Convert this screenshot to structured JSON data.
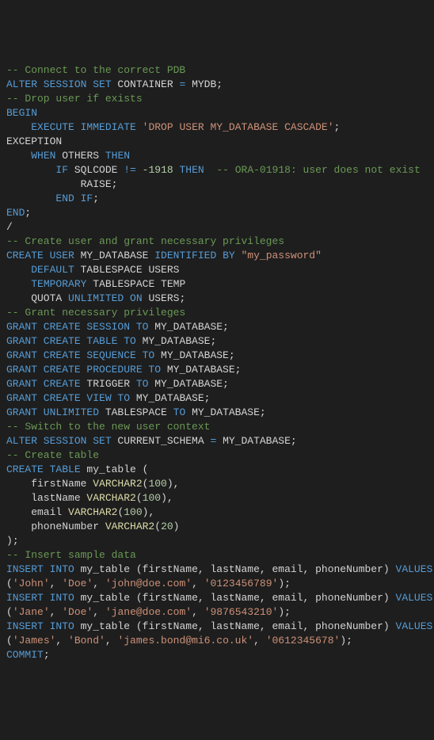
{
  "code": {
    "lines": [
      [
        {
          "cls": "cmt",
          "text": "-- Connect to the correct PDB"
        }
      ],
      [
        {
          "cls": "kw",
          "text": "ALTER SESSION SET"
        },
        {
          "cls": "ident",
          "text": " CONTAINER "
        },
        {
          "cls": "kw",
          "text": "="
        },
        {
          "cls": "ident",
          "text": " MYDB"
        },
        {
          "cls": "ident",
          "text": ";"
        }
      ],
      [
        {
          "cls": "cmt",
          "text": "-- Drop user if exists"
        }
      ],
      [
        {
          "cls": "kw",
          "text": "BEGIN"
        }
      ],
      [
        {
          "cls": "ident",
          "text": "    "
        },
        {
          "cls": "kw",
          "text": "EXECUTE IMMEDIATE"
        },
        {
          "cls": "ident",
          "text": " "
        },
        {
          "cls": "str",
          "text": "'DROP USER MY_DATABASE CASCADE'"
        },
        {
          "cls": "ident",
          "text": ";"
        }
      ],
      [
        {
          "cls": "ident",
          "text": "EXCEPTION"
        }
      ],
      [
        {
          "cls": "ident",
          "text": "    "
        },
        {
          "cls": "kw",
          "text": "WHEN"
        },
        {
          "cls": "ident",
          "text": " OTHERS "
        },
        {
          "cls": "kw",
          "text": "THEN"
        }
      ],
      [
        {
          "cls": "ident",
          "text": "        "
        },
        {
          "cls": "kw",
          "text": "IF"
        },
        {
          "cls": "ident",
          "text": " SQLCODE "
        },
        {
          "cls": "kw",
          "text": "!="
        },
        {
          "cls": "ident",
          "text": " "
        },
        {
          "cls": "num",
          "text": "-1918"
        },
        {
          "cls": "ident",
          "text": " "
        },
        {
          "cls": "kw",
          "text": "THEN"
        },
        {
          "cls": "ident",
          "text": "  "
        },
        {
          "cls": "cmt",
          "text": "-- ORA-01918: user does not exist"
        }
      ],
      [
        {
          "cls": "ident",
          "text": "            RAISE;"
        }
      ],
      [
        {
          "cls": "ident",
          "text": "        "
        },
        {
          "cls": "kw",
          "text": "END IF"
        },
        {
          "cls": "ident",
          "text": ";"
        }
      ],
      [
        {
          "cls": "kw",
          "text": "END"
        },
        {
          "cls": "ident",
          "text": ";"
        }
      ],
      [
        {
          "cls": "ident",
          "text": "/"
        }
      ],
      [
        {
          "cls": "cmt",
          "text": "-- Create user and grant necessary privileges"
        }
      ],
      [
        {
          "cls": "kw",
          "text": "CREATE USER"
        },
        {
          "cls": "ident",
          "text": " MY_DATABASE "
        },
        {
          "cls": "kw",
          "text": "IDENTIFIED BY"
        },
        {
          "cls": "ident",
          "text": " "
        },
        {
          "cls": "str",
          "text": "\"my_password\""
        }
      ],
      [
        {
          "cls": "ident",
          "text": "    "
        },
        {
          "cls": "kw",
          "text": "DEFAULT"
        },
        {
          "cls": "ident",
          "text": " TABLESPACE USERS"
        }
      ],
      [
        {
          "cls": "ident",
          "text": "    "
        },
        {
          "cls": "kw",
          "text": "TEMPORARY"
        },
        {
          "cls": "ident",
          "text": " TABLESPACE TEMP"
        }
      ],
      [
        {
          "cls": "ident",
          "text": "    QUOTA "
        },
        {
          "cls": "kw",
          "text": "UNLIMITED ON"
        },
        {
          "cls": "ident",
          "text": " USERS;"
        }
      ],
      [
        {
          "cls": "cmt",
          "text": "-- Grant necessary privileges"
        }
      ],
      [
        {
          "cls": "kw",
          "text": "GRANT CREATE SESSION TO"
        },
        {
          "cls": "ident",
          "text": " MY_DATABASE;"
        }
      ],
      [
        {
          "cls": "kw",
          "text": "GRANT CREATE TABLE TO"
        },
        {
          "cls": "ident",
          "text": " MY_DATABASE;"
        }
      ],
      [
        {
          "cls": "kw",
          "text": "GRANT CREATE SEQUENCE TO"
        },
        {
          "cls": "ident",
          "text": " MY_DATABASE;"
        }
      ],
      [
        {
          "cls": "kw",
          "text": "GRANT CREATE PROCEDURE TO"
        },
        {
          "cls": "ident",
          "text": " MY_DATABASE;"
        }
      ],
      [
        {
          "cls": "kw",
          "text": "GRANT CREATE"
        },
        {
          "cls": "ident",
          "text": " TRIGGER "
        },
        {
          "cls": "kw",
          "text": "TO"
        },
        {
          "cls": "ident",
          "text": " MY_DATABASE;"
        }
      ],
      [
        {
          "cls": "kw",
          "text": "GRANT CREATE VIEW TO"
        },
        {
          "cls": "ident",
          "text": " MY_DATABASE;"
        }
      ],
      [
        {
          "cls": "kw",
          "text": "GRANT UNLIMITED"
        },
        {
          "cls": "ident",
          "text": " TABLESPACE "
        },
        {
          "cls": "kw",
          "text": "TO"
        },
        {
          "cls": "ident",
          "text": " MY_DATABASE;"
        }
      ],
      [
        {
          "cls": "cmt",
          "text": "-- Switch to the new user context"
        }
      ],
      [
        {
          "cls": "kw",
          "text": "ALTER SESSION SET"
        },
        {
          "cls": "ident",
          "text": " CURRENT_SCHEMA "
        },
        {
          "cls": "kw",
          "text": "="
        },
        {
          "cls": "ident",
          "text": " MY_DATABASE;"
        }
      ],
      [
        {
          "cls": "cmt",
          "text": "-- Create table"
        }
      ],
      [
        {
          "cls": "kw",
          "text": "CREATE TABLE"
        },
        {
          "cls": "ident",
          "text": " my_table "
        },
        {
          "cls": "paren",
          "text": "("
        }
      ],
      [
        {
          "cls": "ident",
          "text": "    firstName "
        },
        {
          "cls": "func",
          "text": "VARCHAR2"
        },
        {
          "cls": "paren",
          "text": "("
        },
        {
          "cls": "num",
          "text": "100"
        },
        {
          "cls": "paren",
          "text": ")"
        },
        {
          "cls": "ident",
          "text": ","
        }
      ],
      [
        {
          "cls": "ident",
          "text": "    lastName "
        },
        {
          "cls": "func",
          "text": "VARCHAR2"
        },
        {
          "cls": "paren",
          "text": "("
        },
        {
          "cls": "num",
          "text": "100"
        },
        {
          "cls": "paren",
          "text": ")"
        },
        {
          "cls": "ident",
          "text": ","
        }
      ],
      [
        {
          "cls": "ident",
          "text": "    email "
        },
        {
          "cls": "func",
          "text": "VARCHAR2"
        },
        {
          "cls": "paren",
          "text": "("
        },
        {
          "cls": "num",
          "text": "100"
        },
        {
          "cls": "paren",
          "text": ")"
        },
        {
          "cls": "ident",
          "text": ","
        }
      ],
      [
        {
          "cls": "ident",
          "text": "    phoneNumber "
        },
        {
          "cls": "func",
          "text": "VARCHAR2"
        },
        {
          "cls": "paren",
          "text": "("
        },
        {
          "cls": "num",
          "text": "20"
        },
        {
          "cls": "paren",
          "text": ")"
        }
      ],
      [
        {
          "cls": "paren",
          "text": ")"
        },
        {
          "cls": "ident",
          "text": ";"
        }
      ],
      [
        {
          "cls": "cmt",
          "text": "-- Insert sample data"
        }
      ],
      [
        {
          "cls": "kw",
          "text": "INSERT INTO"
        },
        {
          "cls": "ident",
          "text": " my_table "
        },
        {
          "cls": "paren",
          "text": "("
        },
        {
          "cls": "ident",
          "text": "firstName, lastName, email, phoneNumber"
        },
        {
          "cls": "paren",
          "text": ")"
        },
        {
          "cls": "ident",
          "text": " "
        },
        {
          "cls": "kw",
          "text": "VALUES"
        }
      ],
      [
        {
          "cls": "paren",
          "text": "("
        },
        {
          "cls": "str",
          "text": "'John'"
        },
        {
          "cls": "ident",
          "text": ", "
        },
        {
          "cls": "str",
          "text": "'Doe'"
        },
        {
          "cls": "ident",
          "text": ", "
        },
        {
          "cls": "str",
          "text": "'john@doe.com'"
        },
        {
          "cls": "ident",
          "text": ", "
        },
        {
          "cls": "str",
          "text": "'0123456789'"
        },
        {
          "cls": "paren",
          "text": ")"
        },
        {
          "cls": "ident",
          "text": ";"
        }
      ],
      [
        {
          "cls": "kw",
          "text": "INSERT INTO"
        },
        {
          "cls": "ident",
          "text": " my_table "
        },
        {
          "cls": "paren",
          "text": "("
        },
        {
          "cls": "ident",
          "text": "firstName, lastName, email, phoneNumber"
        },
        {
          "cls": "paren",
          "text": ")"
        },
        {
          "cls": "ident",
          "text": " "
        },
        {
          "cls": "kw",
          "text": "VALUES"
        }
      ],
      [
        {
          "cls": "paren",
          "text": "("
        },
        {
          "cls": "str",
          "text": "'Jane'"
        },
        {
          "cls": "ident",
          "text": ", "
        },
        {
          "cls": "str",
          "text": "'Doe'"
        },
        {
          "cls": "ident",
          "text": ", "
        },
        {
          "cls": "str",
          "text": "'jane@doe.com'"
        },
        {
          "cls": "ident",
          "text": ", "
        },
        {
          "cls": "str",
          "text": "'9876543210'"
        },
        {
          "cls": "paren",
          "text": ")"
        },
        {
          "cls": "ident",
          "text": ";"
        }
      ],
      [
        {
          "cls": "kw",
          "text": "INSERT INTO"
        },
        {
          "cls": "ident",
          "text": " my_table "
        },
        {
          "cls": "paren",
          "text": "("
        },
        {
          "cls": "ident",
          "text": "firstName, lastName, email, phoneNumber"
        },
        {
          "cls": "paren",
          "text": ")"
        },
        {
          "cls": "ident",
          "text": " "
        },
        {
          "cls": "kw",
          "text": "VALUES"
        }
      ],
      [
        {
          "cls": "paren",
          "text": "("
        },
        {
          "cls": "str",
          "text": "'James'"
        },
        {
          "cls": "ident",
          "text": ", "
        },
        {
          "cls": "str",
          "text": "'Bond'"
        },
        {
          "cls": "ident",
          "text": ", "
        },
        {
          "cls": "str",
          "text": "'james.bond@mi6.co.uk'"
        },
        {
          "cls": "ident",
          "text": ", "
        },
        {
          "cls": "str",
          "text": "'0612345678'"
        },
        {
          "cls": "paren",
          "text": ")"
        },
        {
          "cls": "ident",
          "text": ";"
        }
      ],
      [
        {
          "cls": "kw",
          "text": "COMMIT"
        },
        {
          "cls": "ident",
          "text": ";"
        }
      ]
    ]
  }
}
